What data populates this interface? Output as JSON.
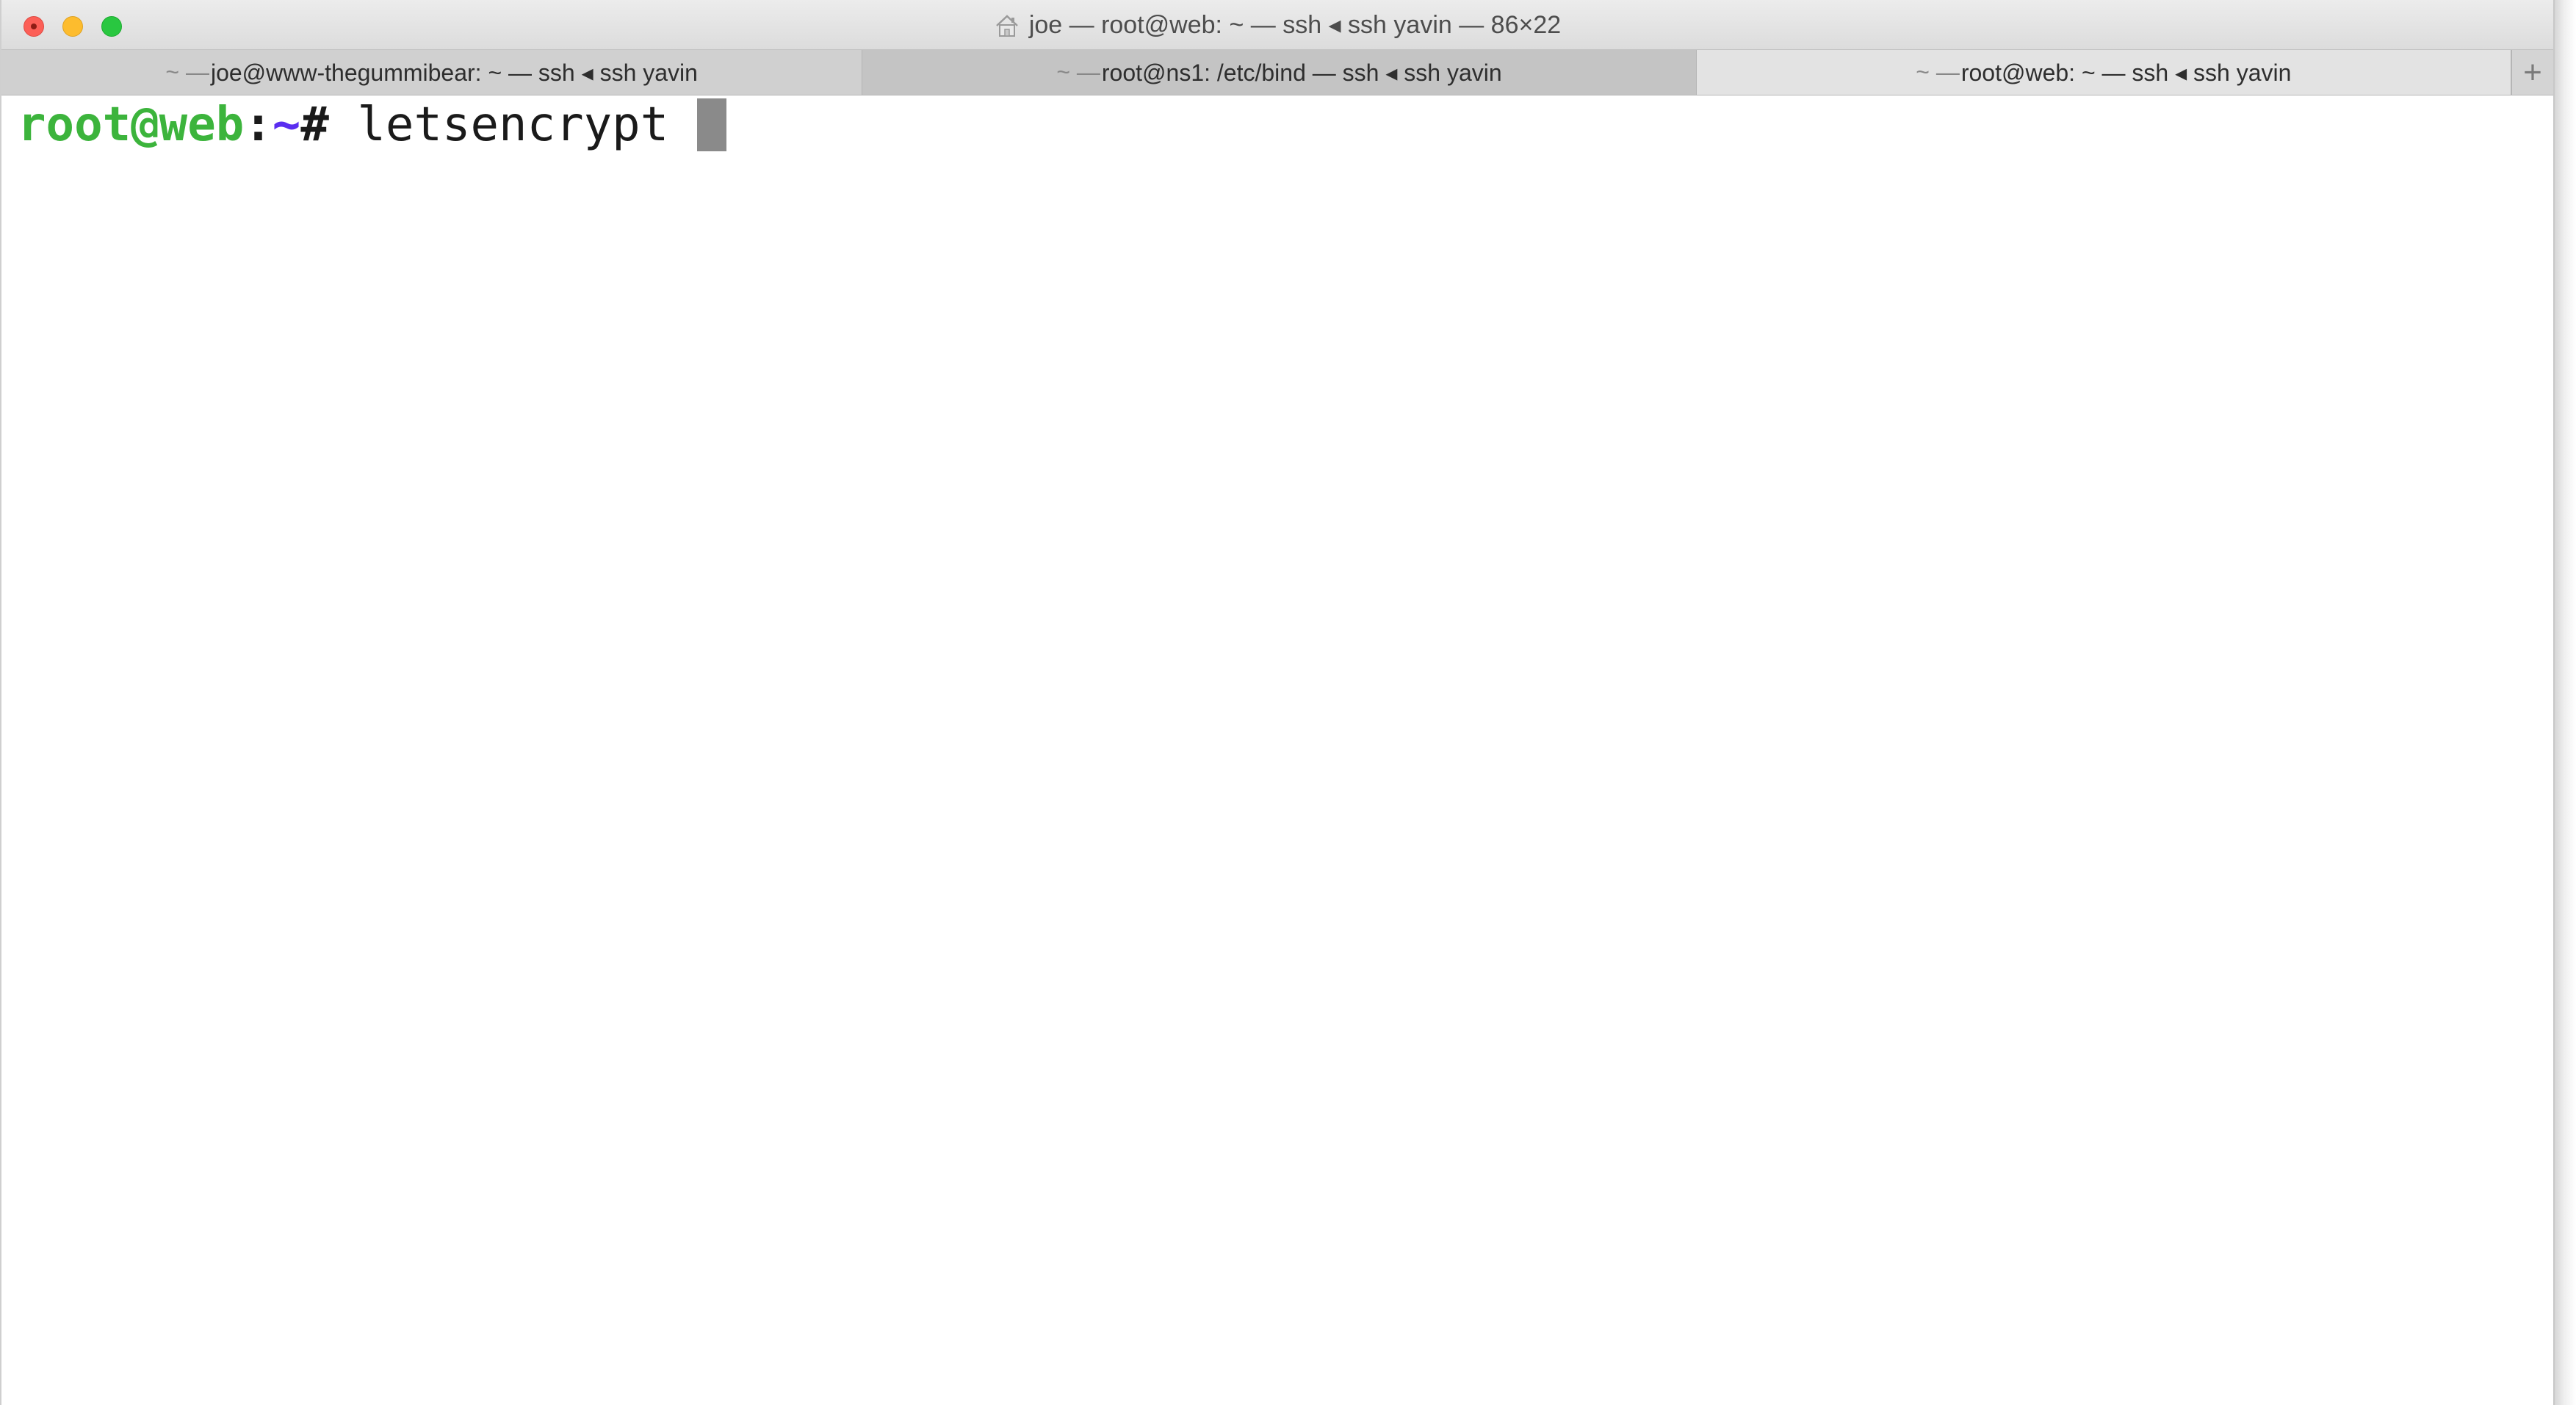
{
  "window": {
    "title": "joe — root@web: ~ — ssh ◂ ssh yavin — 86×22"
  },
  "tabs": [
    {
      "prefix": "~ —",
      "label": " joe@www-thegummibear: ~ — ssh ◂ ssh yavin",
      "active": false
    },
    {
      "prefix": "~ —",
      "label": " root@ns1: /etc/bind — ssh ◂ ssh yavin",
      "active": false
    },
    {
      "prefix": "~ —",
      "label": " root@web: ~ — ssh ◂ ssh yavin",
      "active": true
    }
  ],
  "new_tab": {
    "symbol": "+"
  },
  "terminal": {
    "prompt_user_host": "root@web",
    "prompt_colon": ":",
    "prompt_path": "~",
    "prompt_symbol": "#",
    "command": " letsencrypt "
  },
  "colors": {
    "prompt_user": "#3cb43c",
    "prompt_path": "#5a2df0",
    "close": "#fc5f57",
    "minimize": "#fdbc2e",
    "zoom": "#29c740"
  },
  "icons": {
    "title": "home-icon",
    "close": "close-icon",
    "minimize": "minimize-icon",
    "zoom": "zoom-icon",
    "new_tab": "plus-icon"
  }
}
